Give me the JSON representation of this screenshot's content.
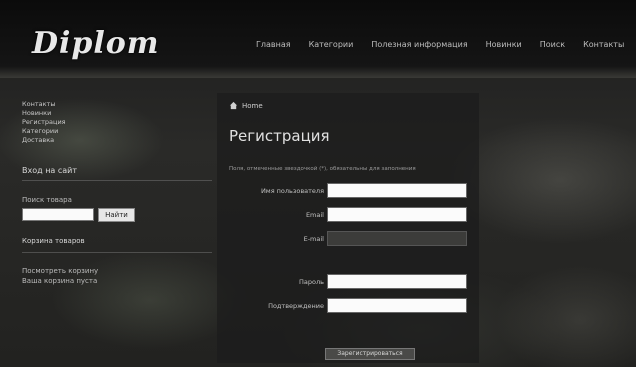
{
  "header": {
    "logo": "Diplom",
    "nav": [
      "Главная",
      "Категории",
      "Полезная информация",
      "Новинки",
      "Поиск",
      "Контакты"
    ]
  },
  "sidebar": {
    "links": [
      "Контакты",
      "Новинки",
      "Регистрация",
      "Категории",
      "Доставка"
    ],
    "login_heading": "Вход на сайт",
    "search_heading": "Поиск товара",
    "search_input_value": "",
    "search_button": "Найти",
    "cart_heading": "Корзина товаров",
    "extra_links": [
      "Посмотреть корзину",
      "Ваша корзина пуста"
    ]
  },
  "main": {
    "breadcrumb": "Home",
    "title": "Регистрация",
    "hint": "Поля, отмеченные звездочкой (*), обязательны для заполнения",
    "fields": [
      {
        "label": "Имя пользователя",
        "value": ""
      },
      {
        "label": "Email",
        "value": ""
      },
      {
        "label": "E-mail",
        "value": ""
      },
      {
        "label": "Пароль",
        "value": ""
      },
      {
        "label": "Подтверждение",
        "value": ""
      }
    ],
    "submit": "Зарегистрироваться"
  }
}
